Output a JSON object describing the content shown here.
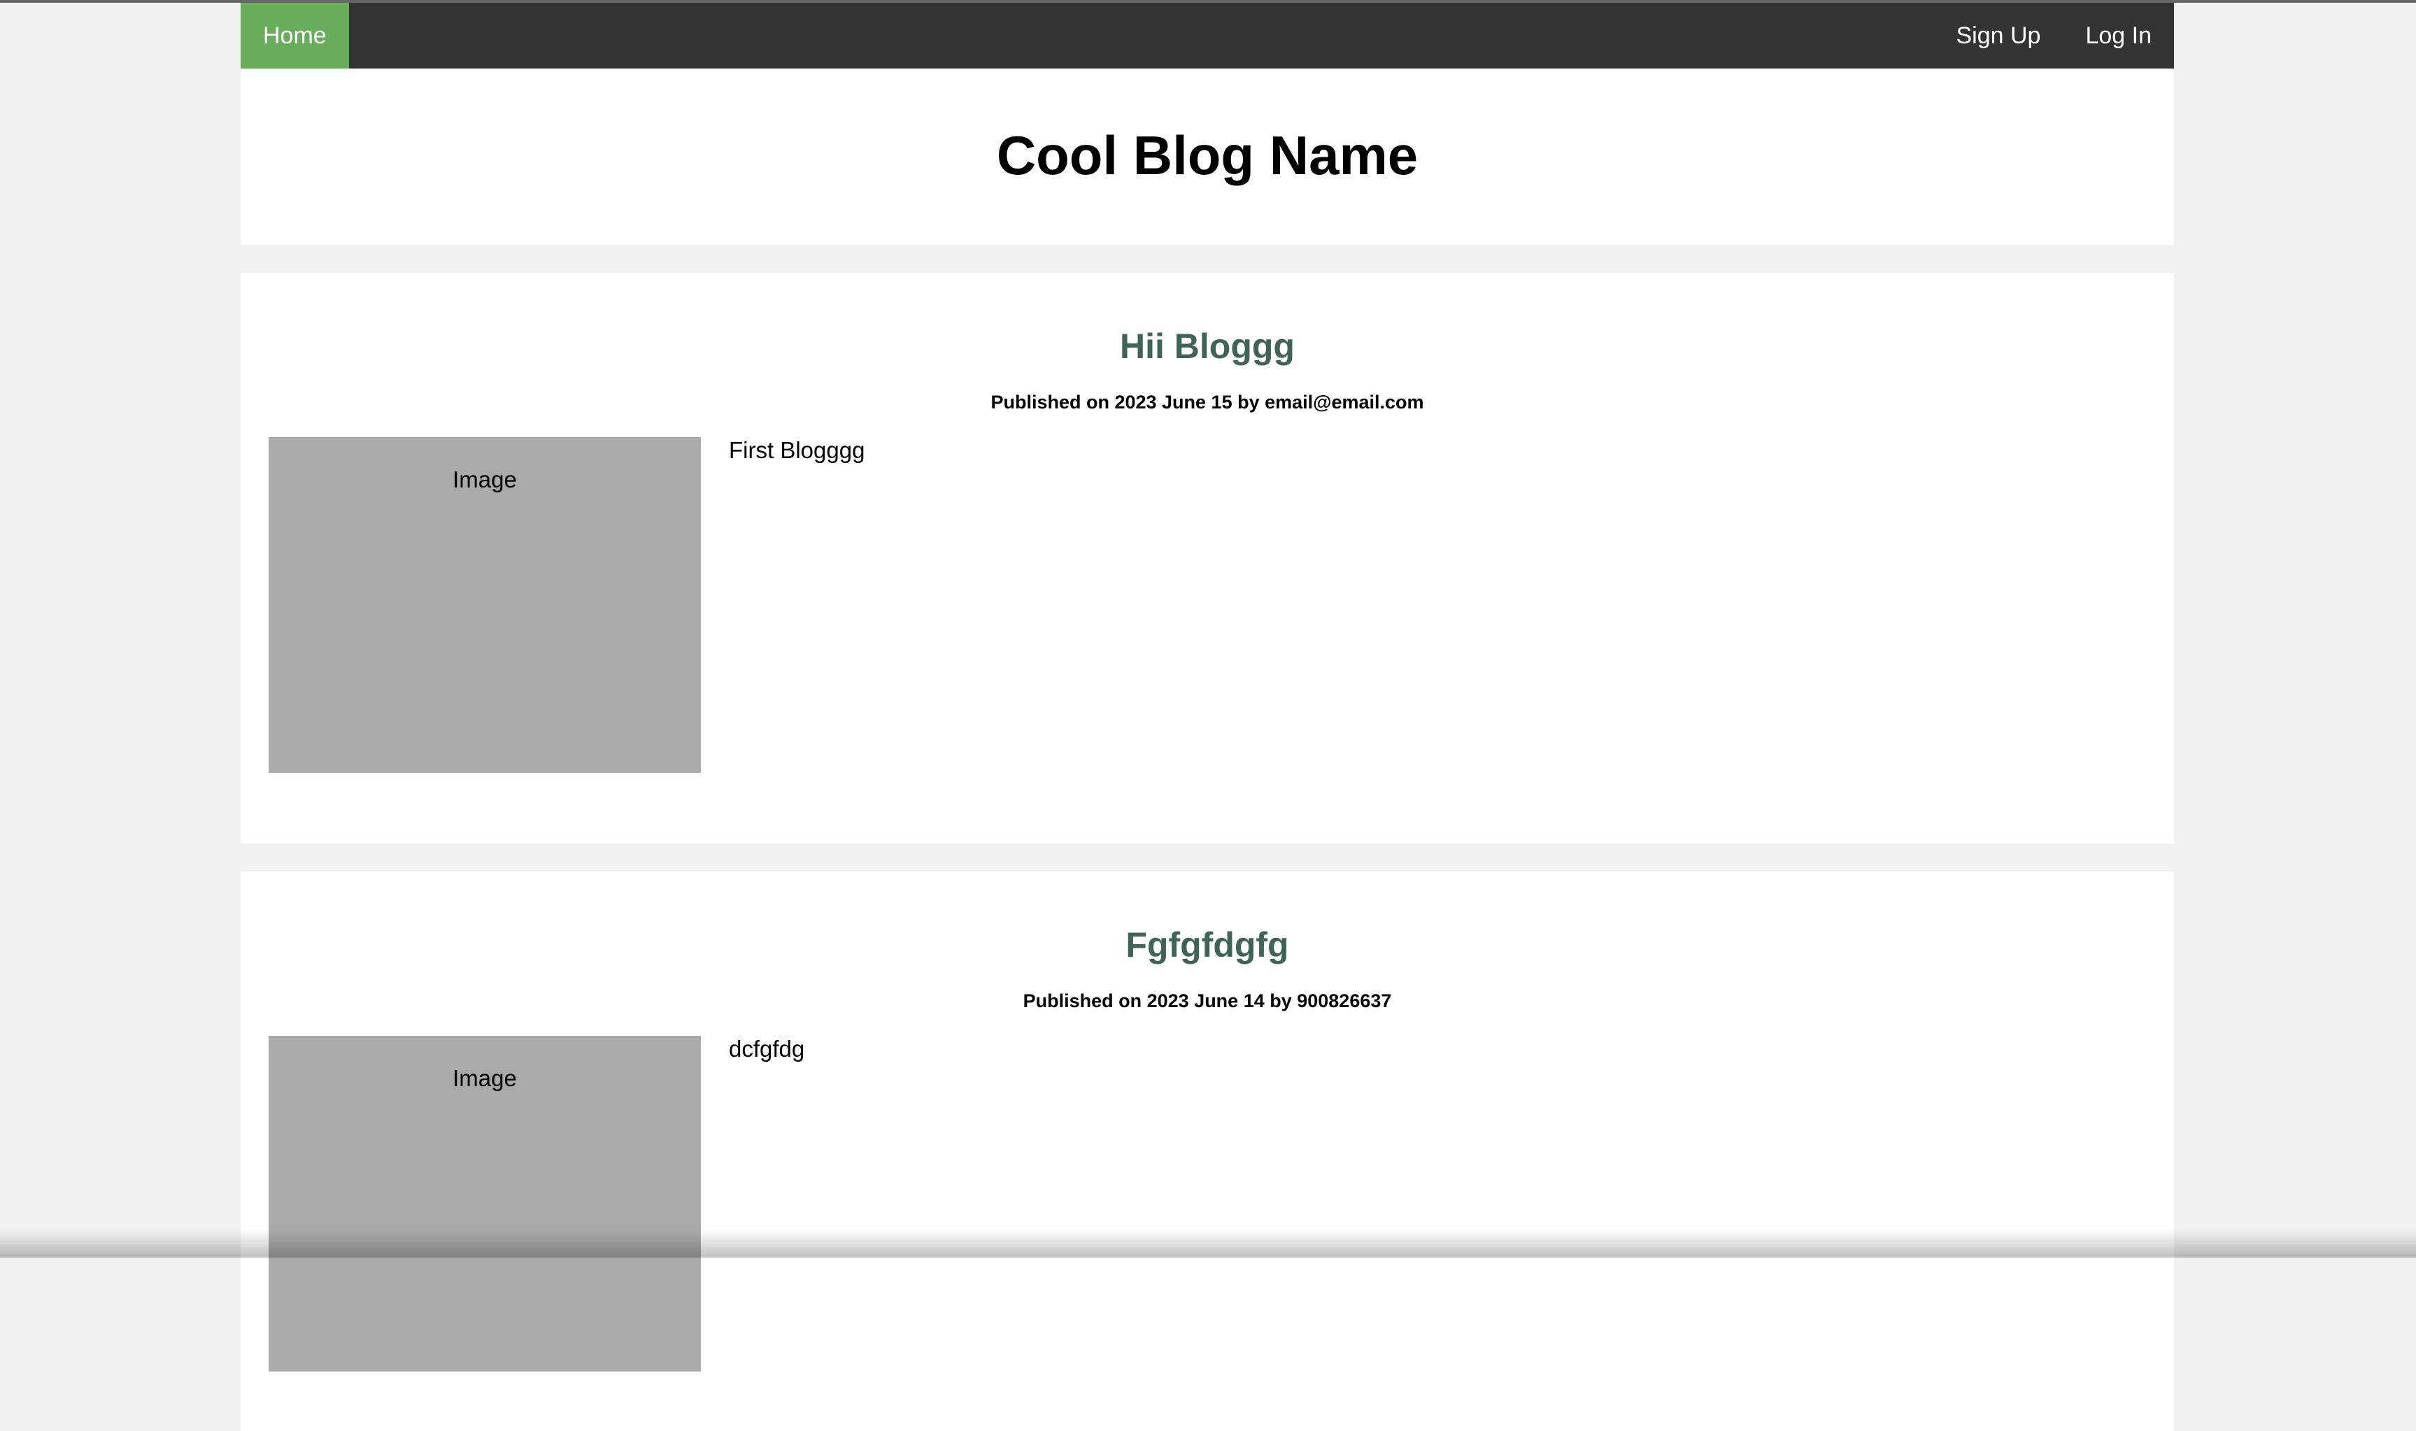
{
  "nav": {
    "home": "Home",
    "signup": "Sign Up",
    "login": "Log In"
  },
  "header": {
    "title": "Cool Blog Name"
  },
  "posts": [
    {
      "title": "Hii Bloggg",
      "meta": "Published on 2023 June 15 by email@email.com",
      "image_label": "Image",
      "body": "First Blogggg"
    },
    {
      "title": "Fgfgfdgfg",
      "meta": "Published on 2023 June 14 by 900826637",
      "image_label": "Image",
      "body": "dcfgfdg"
    }
  ],
  "colors": {
    "nav_bg": "#333333",
    "nav_active": "#67ad5b",
    "post_title": "#3f6354",
    "page_bg": "#f1f1f1",
    "image_placeholder": "#aaaaaa"
  }
}
